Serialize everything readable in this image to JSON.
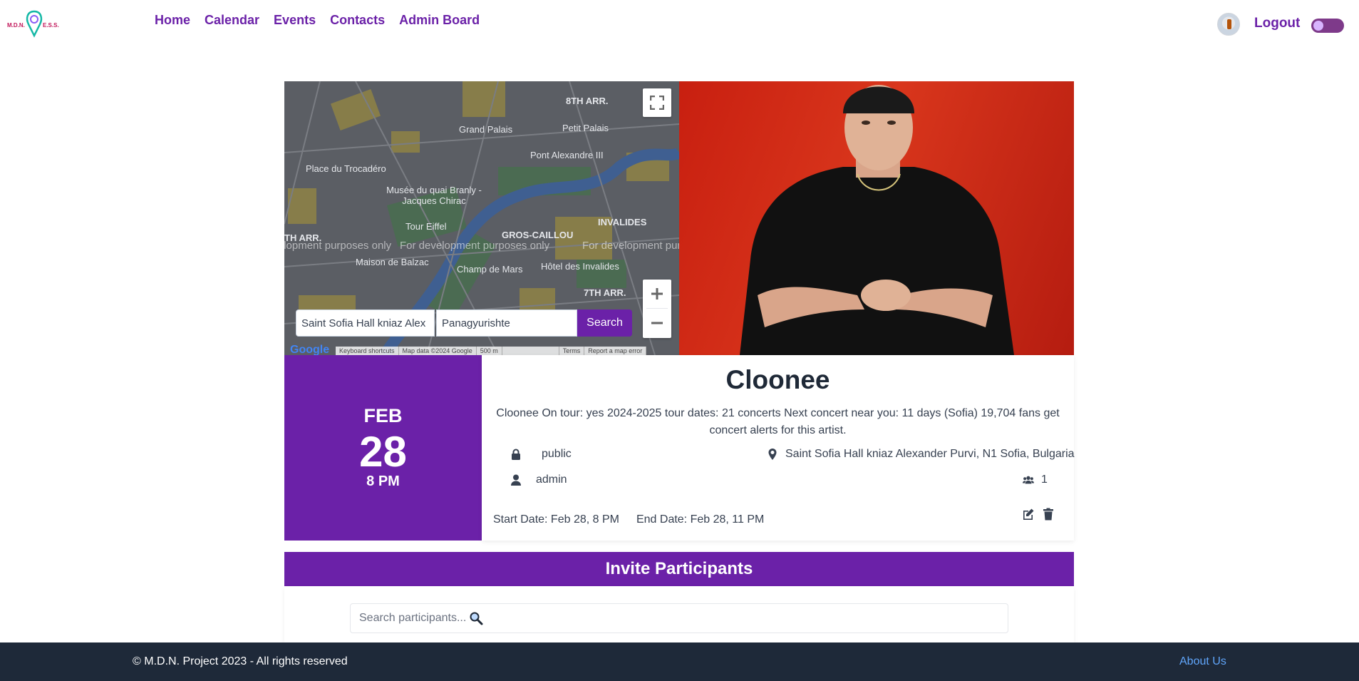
{
  "nav": {
    "logo_text": "M.D.N. E.S.S.",
    "links": [
      "Home",
      "Calendar",
      "Events",
      "Contacts",
      "Admin Board"
    ],
    "logout": "Logout"
  },
  "map": {
    "labels": [
      "8TH ARR.",
      "Grand Palais",
      "Petit Palais",
      "Pont Alexandre III",
      "Place du Trocadéro",
      "Musée du quai Branly - Jacques Chirac",
      "Tour Eiffel",
      "GROS-CAILLOU",
      "INVALIDES",
      "Hôtel des Invalides",
      "Maison de Balzac",
      "Champ de Mars",
      "7TH ARR.",
      "TH ARR."
    ],
    "dev_watermark": "For development purposes only",
    "google": "Google",
    "attribution": [
      "Keyboard shortcuts",
      "Map data ©2024 Google",
      "500 m",
      "Terms",
      "Report a map error"
    ],
    "from_value": "Saint Sofia Hall kniaz Alex",
    "to_value": "Panagyurishte",
    "search_label": "Search"
  },
  "event": {
    "month": "FEB",
    "day": "28",
    "time": "8 PM",
    "title": "Cloonee",
    "description": "Cloonee On tour: yes 2024-2025 tour dates: 21 concerts Next concert near you: 11 days (Sofia) 19,704 fans get concert alerts for this artist.",
    "visibility": "public",
    "location": "Saint Sofia Hall kniaz Alexander Purvi, N1 Sofia, Bulgaria",
    "owner": "admin",
    "participants": "1",
    "start_date": "Start Date: Feb 28, 8 PM",
    "end_date": "End Date: Feb 28, 11 PM"
  },
  "invite": {
    "title": "Invite Participants",
    "placeholder": "Search participants..."
  },
  "footer": {
    "copyright": "© M.D.N. Project 2023 - All rights reserved",
    "about": "About Us"
  },
  "colors": {
    "accent": "#6b21a8",
    "footer_bg": "#1e2939",
    "link_about": "#60a5fa"
  }
}
